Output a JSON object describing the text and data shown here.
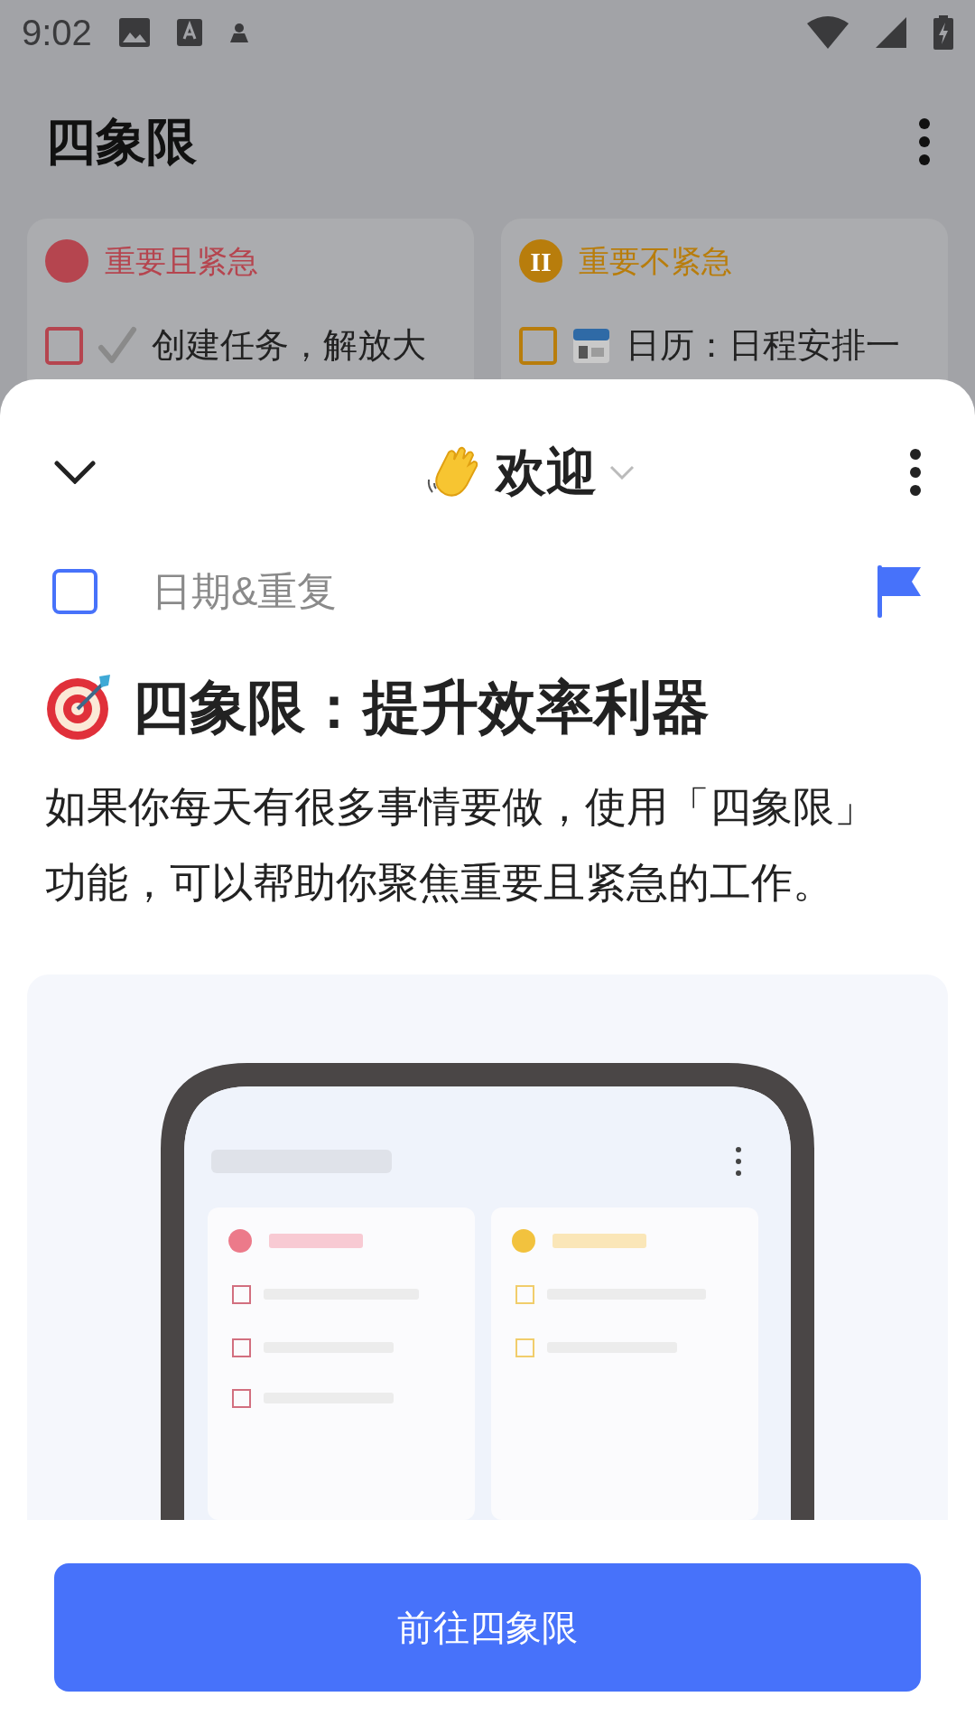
{
  "status_bar": {
    "time": "9:02"
  },
  "app_bar": {
    "title": "四象限"
  },
  "quadrants": [
    {
      "title": "重要且紧急",
      "color": "#b5454f",
      "task": {
        "text": "创建任务，解放大",
        "checked": false,
        "kind": "check"
      }
    },
    {
      "title": "重要不紧急",
      "color": "#b87d0c",
      "badge": "II",
      "task": {
        "text": "日历：日程安排一",
        "checked": false,
        "kind": "calendar"
      }
    }
  ],
  "sheet": {
    "title": "欢迎",
    "checked": false,
    "date_placeholder": "日期&重复",
    "heading": "四象限：提升效率利器",
    "paragraph": "如果你每天有很多事情要做，使用「四象限」功能，可以帮助你聚焦重要且紧急的工作。",
    "button": "前往四象限"
  }
}
